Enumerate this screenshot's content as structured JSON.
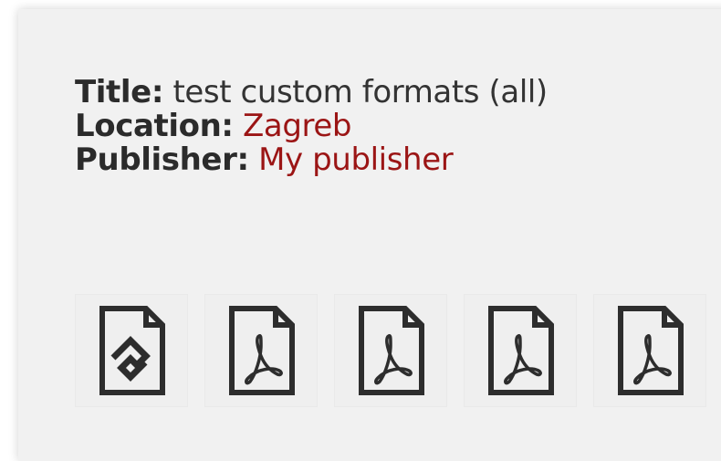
{
  "book": {
    "title_label": "Title:",
    "title_value": "test custom formats (all)",
    "location_label": "Location:",
    "location_value": "Zagreb",
    "publisher_label": "Publisher:",
    "publisher_value": "My publisher"
  },
  "formats": [
    {
      "icon": "epub-file-icon"
    },
    {
      "icon": "pdf-file-icon"
    },
    {
      "icon": "pdf-file-icon"
    },
    {
      "icon": "pdf-file-icon"
    },
    {
      "icon": "pdf-file-icon"
    }
  ],
  "colors": {
    "text": "#333333",
    "link": "#9b1515",
    "card_background": "#f1f1f1",
    "icon_stroke": "#2d2d2d"
  }
}
